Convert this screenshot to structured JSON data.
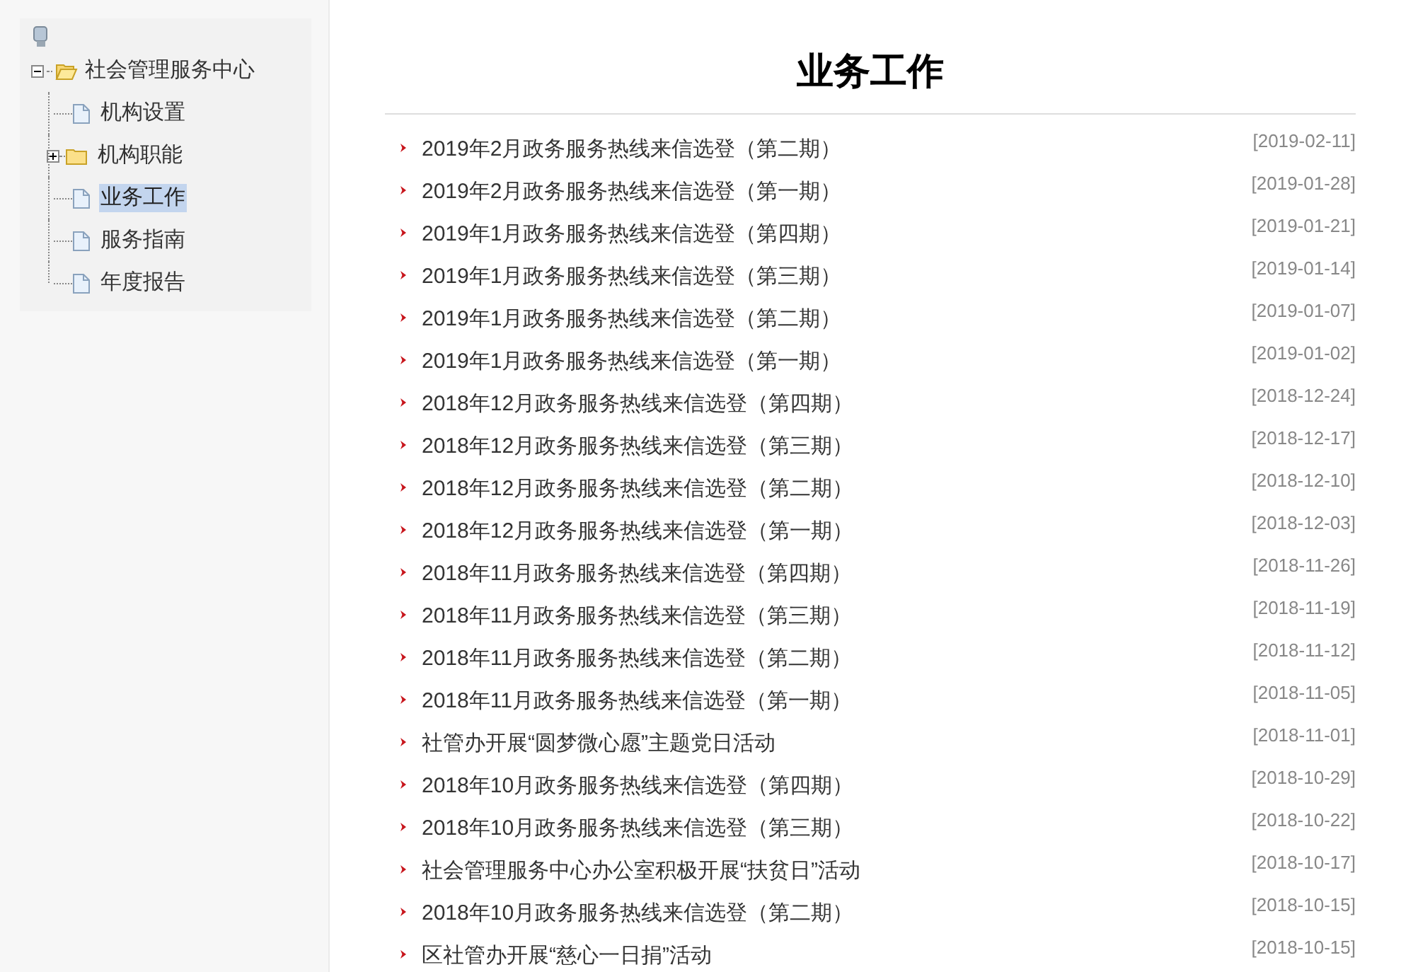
{
  "tree": {
    "label": "社会管理服务中心",
    "kind": "folder",
    "expanded": true,
    "children": [
      {
        "label": "机构设置",
        "kind": "page",
        "selected": false
      },
      {
        "label": "机构职能",
        "kind": "folder",
        "expanded": false,
        "selected": false
      },
      {
        "label": "业务工作",
        "kind": "page",
        "selected": true
      },
      {
        "label": "服务指南",
        "kind": "page",
        "selected": false
      },
      {
        "label": "年度报告",
        "kind": "page",
        "selected": false
      }
    ]
  },
  "page_title": "业务工作",
  "articles": [
    {
      "title": "2019年2月政务服务热线来信选登（第二期）",
      "date": "[2019-02-11]"
    },
    {
      "title": "2019年2月政务服务热线来信选登（第一期）",
      "date": "[2019-01-28]"
    },
    {
      "title": "2019年1月政务服务热线来信选登（第四期）",
      "date": "[2019-01-21]"
    },
    {
      "title": "2019年1月政务服务热线来信选登（第三期）",
      "date": "[2019-01-14]"
    },
    {
      "title": "2019年1月政务服务热线来信选登（第二期）",
      "date": "[2019-01-07]"
    },
    {
      "title": "2019年1月政务服务热线来信选登（第一期）",
      "date": "[2019-01-02]"
    },
    {
      "title": "2018年12月政务服务热线来信选登（第四期）",
      "date": "[2018-12-24]"
    },
    {
      "title": "2018年12月政务服务热线来信选登（第三期）",
      "date": "[2018-12-17]"
    },
    {
      "title": "2018年12月政务服务热线来信选登（第二期）",
      "date": "[2018-12-10]"
    },
    {
      "title": "2018年12月政务服务热线来信选登（第一期）",
      "date": "[2018-12-03]"
    },
    {
      "title": "2018年11月政务服务热线来信选登（第四期）",
      "date": "[2018-11-26]"
    },
    {
      "title": "2018年11月政务服务热线来信选登（第三期）",
      "date": "[2018-11-19]"
    },
    {
      "title": "2018年11月政务服务热线来信选登（第二期）",
      "date": "[2018-11-12]"
    },
    {
      "title": "2018年11月政务服务热线来信选登（第一期）",
      "date": "[2018-11-05]"
    },
    {
      "title": "社管办开展“圆梦微心愿”主题党日活动",
      "date": "[2018-11-01]"
    },
    {
      "title": "2018年10月政务服务热线来信选登（第四期）",
      "date": "[2018-10-29]"
    },
    {
      "title": "2018年10月政务服务热线来信选登（第三期）",
      "date": "[2018-10-22]"
    },
    {
      "title": "社会管理服务中心办公室积极开展“扶贫日”活动",
      "date": "[2018-10-17]"
    },
    {
      "title": "2018年10月政务服务热线来信选登（第二期）",
      "date": "[2018-10-15]"
    },
    {
      "title": "区社管办开展“慈心一日捐”活动",
      "date": "[2018-10-15]"
    }
  ]
}
